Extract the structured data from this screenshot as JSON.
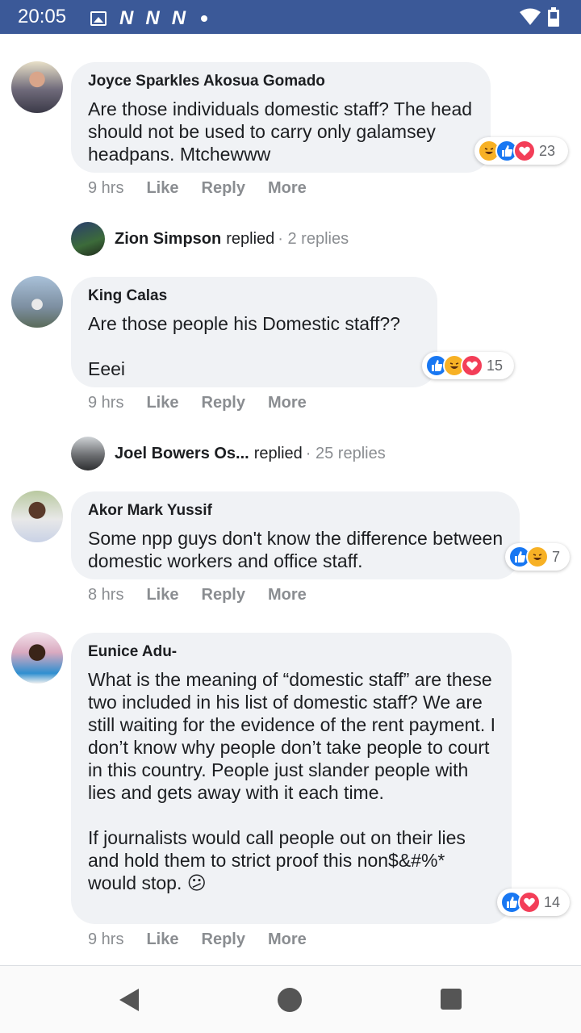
{
  "status_bar": {
    "time": "20:05",
    "notification_letter": "N",
    "icons": [
      "image-icon",
      "n-icon",
      "n-icon",
      "n-icon",
      "dot-icon",
      "wifi-icon",
      "battery-icon"
    ],
    "color": "#3b5998"
  },
  "actions": {
    "like": "Like",
    "reply": "Reply",
    "more": "More"
  },
  "comments": [
    {
      "author": "Joyce Sparkles Akosua Gomado",
      "text": "Are those individuals domestic staff? The head should not be used to carry only galamsey headpans. Mtchewww",
      "time": "9 hrs",
      "reactions": [
        "haha",
        "like",
        "love"
      ],
      "reaction_count": "23",
      "reply_summary": {
        "name": "Zion Simpson",
        "verb": "replied",
        "count": "· 2 replies"
      }
    },
    {
      "author": "King Calas",
      "text": "Are those people his Domestic staff??\n\nEeei",
      "time": "9 hrs",
      "reactions": [
        "like",
        "haha",
        "love"
      ],
      "reaction_count": "15",
      "reply_summary": {
        "name": "Joel Bowers Os...",
        "verb": "replied",
        "count": "· 25 replies"
      }
    },
    {
      "author": "Akor Mark Yussif",
      "text": "Some npp guys don't know the difference between domestic workers and office staff.",
      "time": "8 hrs",
      "reactions": [
        "like",
        "haha"
      ],
      "reaction_count": "7"
    },
    {
      "author": "Eunice Adu-",
      "text": "What is the meaning of “domestic staff” are these two included in his list of domestic staff? We are still waiting for the evidence of the rent payment. I don’t know why people don’t take people to court in this country. People just slander people with lies and gets away with it each time.\n\nIf journalists would call people out on their lies and hold them to strict proof this non$&#%* would stop.",
      "emoji": "😕",
      "time": "9 hrs",
      "reactions": [
        "like",
        "love"
      ],
      "reaction_count": "14"
    }
  ],
  "colors": {
    "bubble": "#f0f2f5",
    "like": "#1877f2",
    "love": "#f33e58",
    "haha": "#f7b125",
    "muted": "#8a8d91"
  }
}
